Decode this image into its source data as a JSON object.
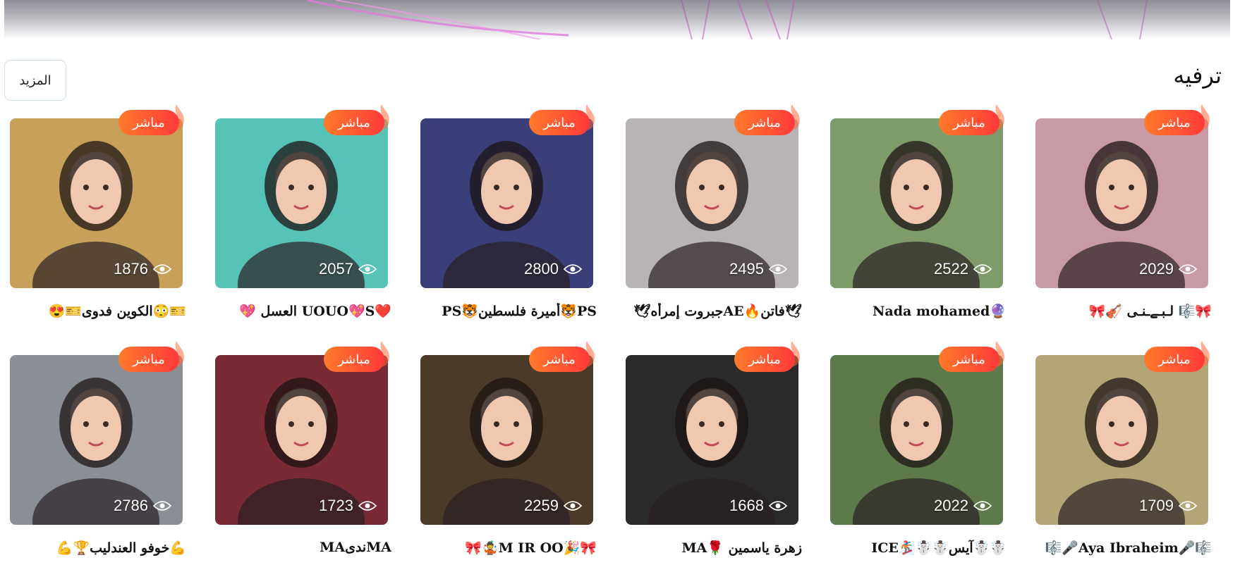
{
  "section": {
    "title": "ترفيه",
    "more_label": "المزيد"
  },
  "live_label": "مباشر",
  "icons": {
    "viewers": "eye-icon",
    "badge": "flame-icon"
  },
  "colors": {
    "badge_start": "#ff7a2a",
    "badge_end": "#ff3a3a",
    "more_border": "#cfe0e6"
  },
  "rows": [
    {
      "cards": [
        {
          "name": "🎀🎼 لـبـےـنـى 🎻🎀",
          "viewers": "2029",
          "tint": "#c89aa6"
        },
        {
          "name": "🔮Nada mohamed",
          "viewers": "2522",
          "tint": "#7f9b6a"
        },
        {
          "name": "🕊فاتن🔥AEجبروت إمرأه🕊",
          "viewers": "2495",
          "tint": "#b7b3b6"
        },
        {
          "name": "PS🐯أميرة فلسطين🐯PS",
          "viewers": "2800",
          "tint": "#3a3f7a"
        },
        {
          "name": "❤️UOUO💖S العسل 💖",
          "viewers": "2057",
          "tint": "#57c3b6"
        },
        {
          "name": "🎫😳الكوين فدوى🎫😍",
          "viewers": "1876",
          "tint": "#c7a15a"
        }
      ]
    },
    {
      "cards": [
        {
          "name": "🎼🎤Aya Ibraheim🎤🎼",
          "viewers": "1709",
          "tint": "#b3a676"
        },
        {
          "name": "☃️☃️آيس☃️☃️🏂ICE",
          "viewers": "2022",
          "tint": "#5f7a4a"
        },
        {
          "name": "زهرة ياسمين 🌹MA",
          "viewers": "1668",
          "tint": "#2a2a2a"
        },
        {
          "name": "🎀🎉M IR OO🤹🎀",
          "viewers": "2259",
          "tint": "#4a3a2a"
        },
        {
          "name": "MAندىMA",
          "viewers": "1723",
          "tint": "#7a2a35"
        },
        {
          "name": "💪خوفو العندليب🏆💪",
          "viewers": "2786",
          "tint": "#8a8f96"
        }
      ]
    }
  ]
}
